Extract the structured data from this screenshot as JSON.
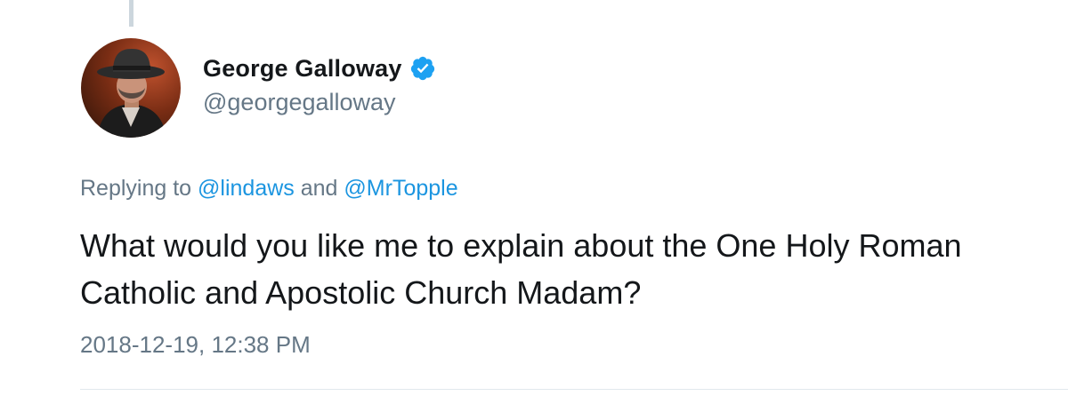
{
  "tweet": {
    "author": {
      "display_name": "George Galloway",
      "handle": "@georgegalloway",
      "verified": true
    },
    "reply": {
      "prefix": "Replying to",
      "mention_1": "@lindaws",
      "conjunction": "and",
      "mention_2": "@MrTopple"
    },
    "text": "What would you like me to explain about the One Holy Roman Catholic and Apostolic Church Madam?",
    "timestamp": "2018-12-19, 12:38 PM"
  },
  "colors": {
    "link": "#1b95e0",
    "secondary_text": "#657786",
    "primary_text": "#14171a",
    "verified_badge": "#1da1f2"
  },
  "icons": {
    "verified": "verified-badge-icon",
    "avatar": "profile-photo"
  }
}
